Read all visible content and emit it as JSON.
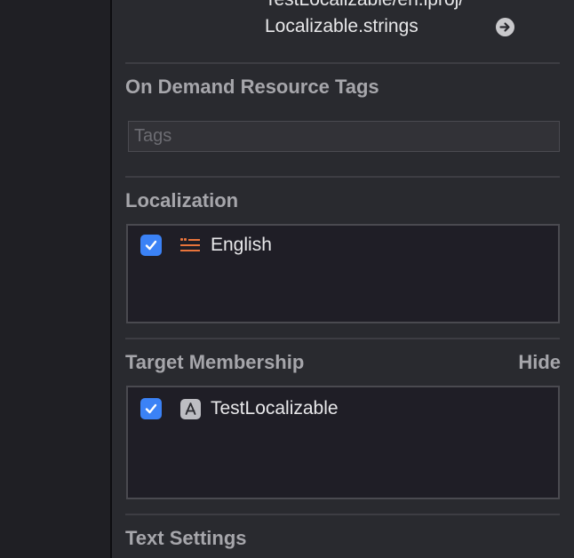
{
  "file": {
    "path_line1": "TestLocalizable/en.lproj/",
    "path_line2": "Localizable.strings",
    "reveal_icon": "arrow-circle-right-icon"
  },
  "sections": {
    "odr": {
      "title": "On Demand Resource Tags",
      "tags_placeholder": "Tags"
    },
    "localization": {
      "title": "Localization",
      "items": [
        {
          "label": "English",
          "checked": true,
          "icon": "strings-file-icon"
        }
      ]
    },
    "target_membership": {
      "title": "Target Membership",
      "hide_label": "Hide",
      "items": [
        {
          "label": "TestLocalizable",
          "checked": true,
          "icon": "app-target-icon"
        }
      ]
    },
    "text_settings": {
      "title": "Text Settings"
    }
  },
  "colors": {
    "checkbox": "#3b82f6",
    "strings_icon": "#e8743b"
  }
}
